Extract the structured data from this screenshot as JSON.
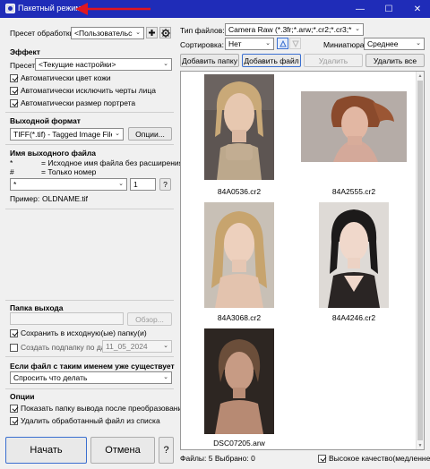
{
  "window": {
    "title": "Пакетный режим",
    "controls": {
      "minimize": "—",
      "maximize": "☐",
      "close": "✕"
    }
  },
  "left": {
    "preset_label": "Пресет обработки",
    "preset_value": "<Пользовательски",
    "effect_header": "Эффект",
    "effect_preset_label": "Пресет",
    "effect_preset_value": "<Текущие настройки>",
    "checks": {
      "skin": "Автоматически цвет кожи",
      "face": "Автоматически исключить черты лица",
      "portrait": "Автоматически размер портрета"
    },
    "output_format_header": "Выходной формат",
    "output_format_value": "TIFF(*.tif) - Tagged Image File",
    "options_button": "Опции...",
    "filename_header": "Имя выходного файла",
    "legend": [
      {
        "sym": "*",
        "desc": "= Исходное имя файла без расширения"
      },
      {
        "sym": "#",
        "desc": "= Только номер"
      }
    ],
    "pattern_value": "*",
    "start_number": "1",
    "help_small": "?",
    "example_label": "Пример:",
    "example_value": "OLDNAME.tif",
    "output_folder_header": "Папка выхода",
    "output_folder_value": "",
    "browse_button": "Обзор...",
    "save_in_source": "Сохранить в исходную(ые) папку(и)",
    "create_subfolder": "Создать подпапку по дате",
    "subfolder_date": "11_05_2024",
    "exists_header": "Если файл с таким именем уже существует",
    "exists_value": "Спросить что делать",
    "options_header": "Опции",
    "show_folder": "Показать папку вывода после преобразования",
    "delete_processed": "Удалить обработанный файл из списка",
    "start_button": "Начать",
    "cancel_button": "Отмена",
    "help_button": "?"
  },
  "right": {
    "filetype_label": "Тип файлов:",
    "filetype_value": "Camera Raw (*.3fr;*.arw;*.cr2;*.cr3;*.crw;*.",
    "sort_label": "Сортировка:",
    "sort_value": "Нет",
    "thumb_label": "Миниатюра:",
    "thumb_value": "Среднее",
    "add_folder": "Добавить папку",
    "add_file": "Добавить файл",
    "remove": "Удалить",
    "remove_all": "Удалить все",
    "files": [
      {
        "name": "84A0536.cr2"
      },
      {
        "name": "84A2555.cr2"
      },
      {
        "name": "84A3068.cr2"
      },
      {
        "name": "84A4246.cr2"
      },
      {
        "name": "DSC07205.arw"
      }
    ],
    "status": "Файлы: 5  Выбрано: 0",
    "high_quality": "Высокое качество(медленнее)"
  },
  "colors": {
    "titlebar": "#1f2cb8",
    "arrow": "#e0161e",
    "primary_border": "#3a6fd0"
  },
  "icons": [
    "app-icon",
    "plus-icon",
    "gear-icon",
    "sort-ascending-icon",
    "sort-descending-icon",
    "chevron-down-icon",
    "red-arrow-icon"
  ]
}
